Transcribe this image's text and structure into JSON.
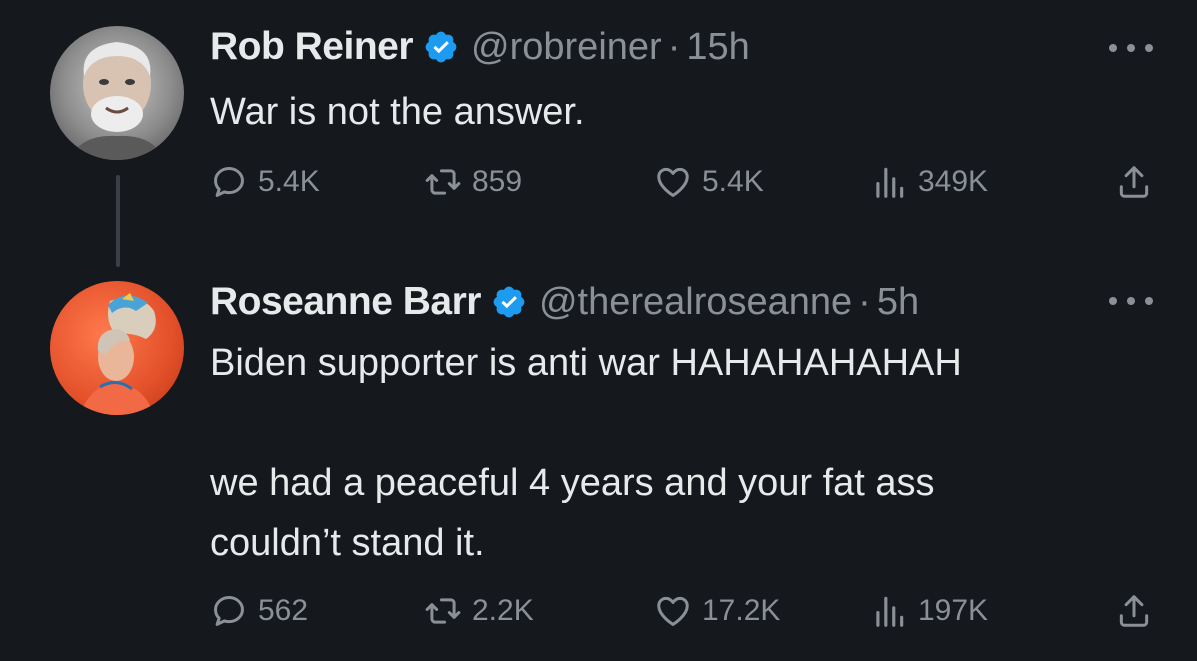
{
  "tweets": [
    {
      "name": "Rob Reiner",
      "handle": "@robreiner",
      "separator": "·",
      "time": "15h",
      "text": "War is not the answer.",
      "stats": {
        "replies": "5.4K",
        "reposts": "859",
        "likes": "5.4K",
        "views": "349K"
      },
      "avatar_icon": "person-photo-icon"
    },
    {
      "name": "Roseanne Barr",
      "handle": "@therealroseanne",
      "separator": "·",
      "time": "5h",
      "text": "Biden supporter is anti war HAHAHAHAHAH\n\nwe had a peaceful 4 years and your fat ass\ncouldn’t stand it.",
      "stats": {
        "replies": "562",
        "reposts": "2.2K",
        "likes": "17.2K",
        "views": "197K"
      },
      "avatar_icon": "person-photo-icon"
    }
  ],
  "colors": {
    "background": "#15181d",
    "primary_text": "#e7e9ea",
    "secondary_text": "#8b9096",
    "verified_badge": "#1d9bf0"
  }
}
